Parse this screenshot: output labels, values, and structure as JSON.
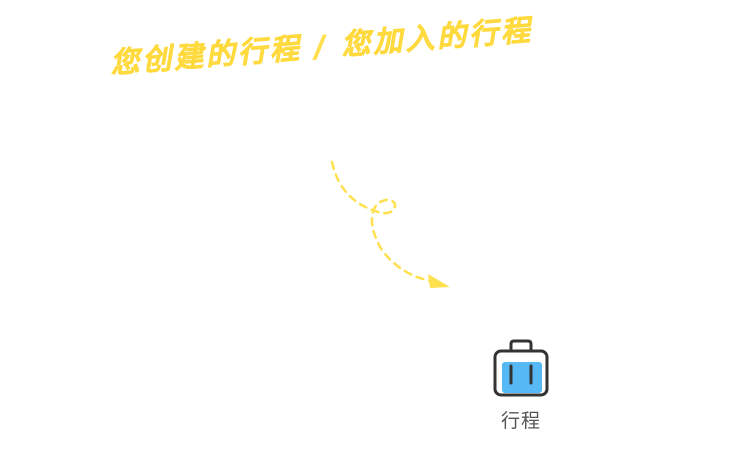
{
  "hint": {
    "text": "您创建的行程 / 您加入的行程"
  },
  "tab": {
    "label": "行程",
    "icon": "suitcase-icon"
  },
  "colors": {
    "hint": "#FFE04F",
    "icon_fill": "#56B8F5",
    "icon_outline": "#333333",
    "label": "#555555",
    "background": "#FFFFFF"
  }
}
